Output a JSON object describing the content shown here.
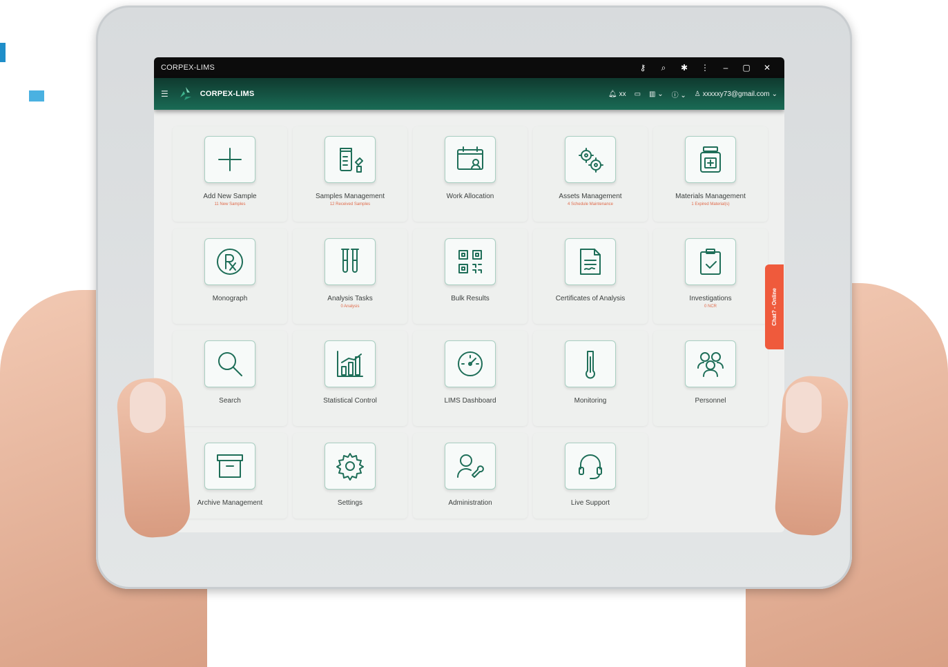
{
  "window": {
    "title": "CORPEX-LIMS",
    "icons": [
      "key-icon",
      "zoom-icon",
      "extension-icon",
      "more-vertical-icon",
      "minimize-icon",
      "maximize-icon",
      "close-icon"
    ]
  },
  "appbar": {
    "brand": "CORPEX-LIMS",
    "notifications_count": "xx",
    "user_email": "xxxxxy73@gmail.com"
  },
  "tiles": [
    {
      "label": "Add New Sample",
      "sub": "11 New Samples",
      "icon": "plus-icon"
    },
    {
      "label": "Samples Management",
      "sub": "12 Received Samples",
      "icon": "sample-bottle-icon"
    },
    {
      "label": "Work Allocation",
      "sub": "",
      "icon": "work-allocation-icon"
    },
    {
      "label": "Assets Management",
      "sub": "4 Schedule Maintenance",
      "icon": "gears-icon"
    },
    {
      "label": "Materials Management",
      "sub": "1 Expired Material(s)",
      "icon": "medicine-jar-icon"
    },
    {
      "label": "Monograph",
      "sub": "",
      "icon": "rx-icon"
    },
    {
      "label": "Analysis Tasks",
      "sub": "0 Analysis",
      "icon": "test-tubes-icon"
    },
    {
      "label": "Bulk Results",
      "sub": "",
      "icon": "qr-code-icon"
    },
    {
      "label": "Certificates of Analysis",
      "sub": "",
      "icon": "certificate-icon"
    },
    {
      "label": "Investigations",
      "sub": "0 NCR",
      "icon": "clipboard-check-icon"
    },
    {
      "label": "Search",
      "sub": "",
      "icon": "search-icon"
    },
    {
      "label": "Statistical Control",
      "sub": "",
      "icon": "bar-chart-icon"
    },
    {
      "label": "LIMS Dashboard",
      "sub": "",
      "icon": "gauge-icon"
    },
    {
      "label": "Monitoring",
      "sub": "",
      "icon": "thermometer-icon"
    },
    {
      "label": "Personnel",
      "sub": "",
      "icon": "people-icon"
    },
    {
      "label": "Archive Management",
      "sub": "",
      "icon": "archive-box-icon"
    },
    {
      "label": "Settings",
      "sub": "",
      "icon": "settings-gear-icon"
    },
    {
      "label": "Administration",
      "sub": "",
      "icon": "admin-user-wrench-icon"
    },
    {
      "label": "Live Support",
      "sub": "",
      "icon": "headset-icon"
    }
  ],
  "chat_tab": "Chat? - Online",
  "colors": {
    "accent": "#1a6b55",
    "alert": "#ef5a3c",
    "titlebar": "#0c0c0c"
  }
}
